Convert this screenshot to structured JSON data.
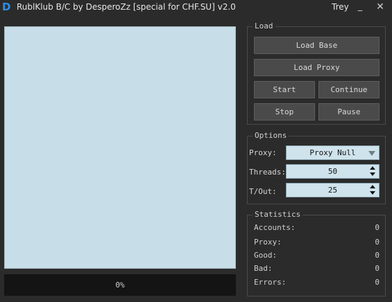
{
  "window": {
    "title": "RublKlub B/C by DesperoZz [special for CHF.SU] v2.0",
    "user": "Trey",
    "icon_letter": "D",
    "minimize_glyph": "_",
    "close_glyph": "✕"
  },
  "progress": {
    "text": "0%",
    "value": 0
  },
  "load_group": {
    "title": "Load",
    "load_base": "Load Base",
    "load_proxy": "Load Proxy",
    "start": "Start",
    "continue": "Continue",
    "stop": "Stop",
    "pause": "Pause"
  },
  "options_group": {
    "title": "Options",
    "proxy_label": "Proxy:",
    "proxy_value": "Proxy Null",
    "threads_label": "Threads:",
    "threads_value": "50",
    "timeout_label": "T/Out:",
    "timeout_value": "25"
  },
  "stats_group": {
    "title": "Statistics",
    "rows": [
      {
        "label": "Accounts:",
        "value": "0"
      },
      {
        "label": "Proxy:",
        "value": "0"
      },
      {
        "label": "Good:",
        "value": "0"
      },
      {
        "label": "Bad:",
        "value": "0"
      },
      {
        "label": "Errors:",
        "value": "0"
      }
    ]
  },
  "colors": {
    "accent": "#2e8fe8",
    "background": "#2b2b2b",
    "list_bg": "#c7dde7",
    "button_bg": "#4a4a4a"
  }
}
